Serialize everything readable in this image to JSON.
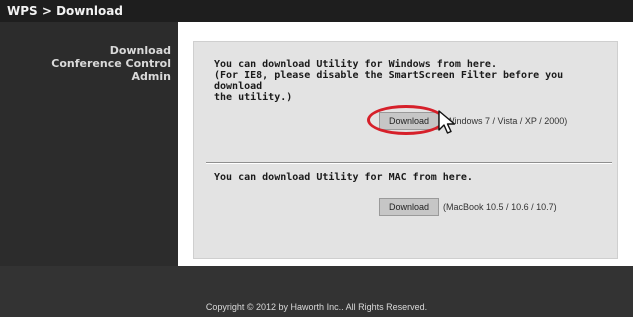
{
  "header": {
    "title": "WPS > Download"
  },
  "sidebar": {
    "items": [
      {
        "label": "Download"
      },
      {
        "label": "Conference Control"
      },
      {
        "label": "Admin"
      }
    ]
  },
  "main": {
    "windows": {
      "lines": [
        "You can download Utility for Windows from here.",
        "(For IE8, please disable the SmartScreen Filter before you download",
        "the utility.)"
      ],
      "button_label": "Download",
      "note": "(Windows 7 / Vista / XP / 2000)"
    },
    "mac": {
      "message": "You can download Utility for MAC from here.",
      "button_label": "Download",
      "note": "(MacBook 10.5 / 10.6 / 10.7)"
    }
  },
  "footer": {
    "text": "Copyright © 2012 by Haworth Inc.. All Rights Reserved."
  },
  "colors": {
    "highlight": "#d6202a",
    "header_bg": "#1e1e1e"
  },
  "icons": {
    "cursor": "mouse-pointer-icon"
  }
}
